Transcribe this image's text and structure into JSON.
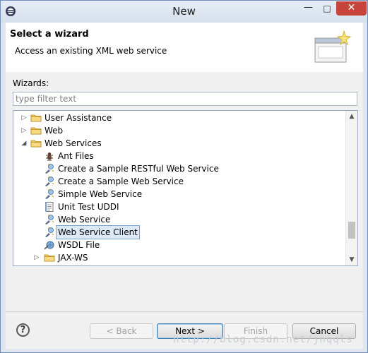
{
  "window": {
    "title": "New",
    "minimize": "—",
    "maximize": "□",
    "close": "✕"
  },
  "header": {
    "title": "Select a wizard",
    "description": "Access an existing XML web service"
  },
  "wizards": {
    "label": "Wizards:",
    "filter_placeholder": "type filter text",
    "filter_value": ""
  },
  "tree": {
    "items": [
      {
        "label": "User Assistance",
        "type": "folder",
        "twisty": "collapsed",
        "indent": 0
      },
      {
        "label": "Web",
        "type": "folder",
        "twisty": "collapsed",
        "indent": 0
      },
      {
        "label": "Web Services",
        "type": "folder",
        "twisty": "expanded",
        "indent": 0
      },
      {
        "label": "Ant Files",
        "type": "ant",
        "indent": 1
      },
      {
        "label": "Create a Sample RESTful Web Service",
        "type": "ws",
        "indent": 1
      },
      {
        "label": "Create a Sample Web Service",
        "type": "ws",
        "indent": 1
      },
      {
        "label": "Simple Web Service",
        "type": "ws",
        "indent": 1
      },
      {
        "label": "Unit Test UDDI",
        "type": "doc",
        "indent": 1
      },
      {
        "label": "Web Service",
        "type": "ws",
        "indent": 1
      },
      {
        "label": "Web Service Client",
        "type": "ws",
        "indent": 1,
        "selected": true
      },
      {
        "label": "WSDL File",
        "type": "wsdl",
        "indent": 1
      },
      {
        "label": "JAX-WS",
        "type": "folder",
        "twisty": "collapsed",
        "indent": 1
      }
    ]
  },
  "buttons": {
    "help": "?",
    "back": "< Back",
    "next": "Next >",
    "finish": "Finish",
    "cancel": "Cancel"
  },
  "watermark": "http://blog.csdn.net/jnqqls",
  "colors": {
    "accent": "#3c7fb1",
    "selection": "#dce9f7",
    "close": "#c7443a"
  }
}
